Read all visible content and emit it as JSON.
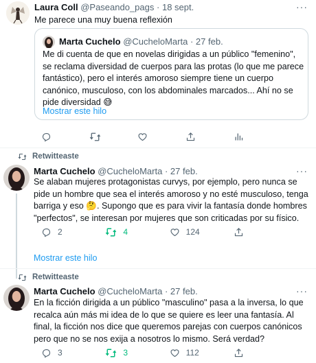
{
  "tweet1": {
    "name": "Laura Coll",
    "handle": "@Paseando_pags",
    "sep": "·",
    "date": "18 sept.",
    "text": "Me parece una muy buena reflexión",
    "quote": {
      "name": "Marta Cuchelo",
      "handle": "@CucheloMarta",
      "sep": "·",
      "date": "27 feb.",
      "text": "Me di cuenta de que en novelas dirigidas a un público \"femenino\", se reclama diversidad de cuerpos para las protas (lo que me parece fantástico), pero el interés amoroso siempre tiene un cuerpo canónico, musculoso, con los abdominales marcados... Ahí no se pide diversidad 😅",
      "show_thread": "Mostrar este hilo"
    }
  },
  "tweet2": {
    "retweeted": "Retwitteaste",
    "name": "Marta Cuchelo",
    "handle": "@CucheloMarta",
    "sep": "·",
    "date": "27 feb.",
    "text": "Se alaban mujeres protagonistas curvys, por ejemplo, pero nunca se pide un hombre que sea el interés amoroso y no esté musculoso, tenga barriga y eso 🤔. Supongo que es para vivir la fantasía donde hombres \"perfectos\", se interesan por mujeres que son criticadas por su físico.",
    "replies": "2",
    "retweets": "4",
    "likes": "124",
    "show_thread": "Mostrar este hilo"
  },
  "tweet3": {
    "retweeted": "Retwitteaste",
    "name": "Marta Cuchelo",
    "handle": "@CucheloMarta",
    "sep": "·",
    "date": "27 feb.",
    "text": "En la ficción dirigida a un público \"masculino\" pasa a la inversa, lo que recalca aún más mi idea de lo que se quiere es leer una fantasía. Al final, la ficción nos dice que queremos parejas con cuerpos canónicos pero que no se nos exija a nosotros lo mismo. Será verdad?",
    "replies": "3",
    "retweets": "3",
    "likes": "112"
  },
  "colors": {
    "accent": "#1d9bf0",
    "retweet_green": "#00ba7c",
    "muted": "#536471",
    "border": "#cfd9de"
  },
  "icons": [
    "more-icon",
    "reply-icon",
    "retweet-icon",
    "like-icon",
    "share-icon",
    "analytics-icon"
  ]
}
